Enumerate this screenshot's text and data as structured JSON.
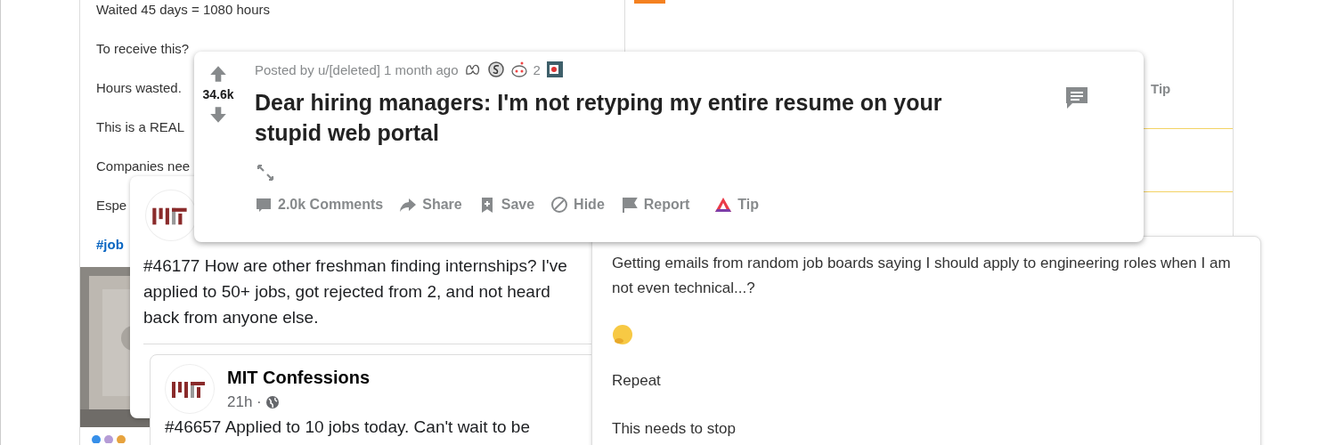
{
  "background_post": {
    "lines": [
      "Waited 45 days = 1080 hours",
      "To receive this?",
      "Hours wasted.",
      "This is a REAL",
      "Companies nee",
      "Espe"
    ],
    "hashtag": "#job"
  },
  "right_post": {
    "tip": "Tip"
  },
  "mit_post": {
    "text": "#46177 How are other freshman finding internships? I've applied to 50+ jobs, got rejected from 2, and not heard back from anyone else.",
    "shared_post": {
      "author": "MIT Confessions",
      "time": "21h ·",
      "text": "#46657 Applied to 10 jobs today. Can't wait to be"
    }
  },
  "reddit_post": {
    "score": "34.6k",
    "meta": "Posted by u/[deleted] 1 month ago",
    "award_count": "2",
    "title": "Dear hiring managers: I'm not retyping my entire resume on your stupid web portal",
    "actions": [
      {
        "kind": "comments",
        "label": "2.0k Comments"
      },
      {
        "kind": "share",
        "label": "Share"
      },
      {
        "kind": "save",
        "label": "Save"
      },
      {
        "kind": "hide",
        "label": "Hide"
      },
      {
        "kind": "report",
        "label": "Report"
      },
      {
        "kind": "tip",
        "label": "Tip"
      }
    ]
  },
  "job_post": {
    "paragraphs": [
      {
        "kind": "text",
        "text": "Getting emails from random job boards saying I should apply to engineering roles when I am not even technical...?"
      },
      {
        "kind": "emoji"
      },
      {
        "kind": "text",
        "text": "Repeat"
      },
      {
        "kind": "text",
        "text": "This needs to stop"
      }
    ]
  }
}
